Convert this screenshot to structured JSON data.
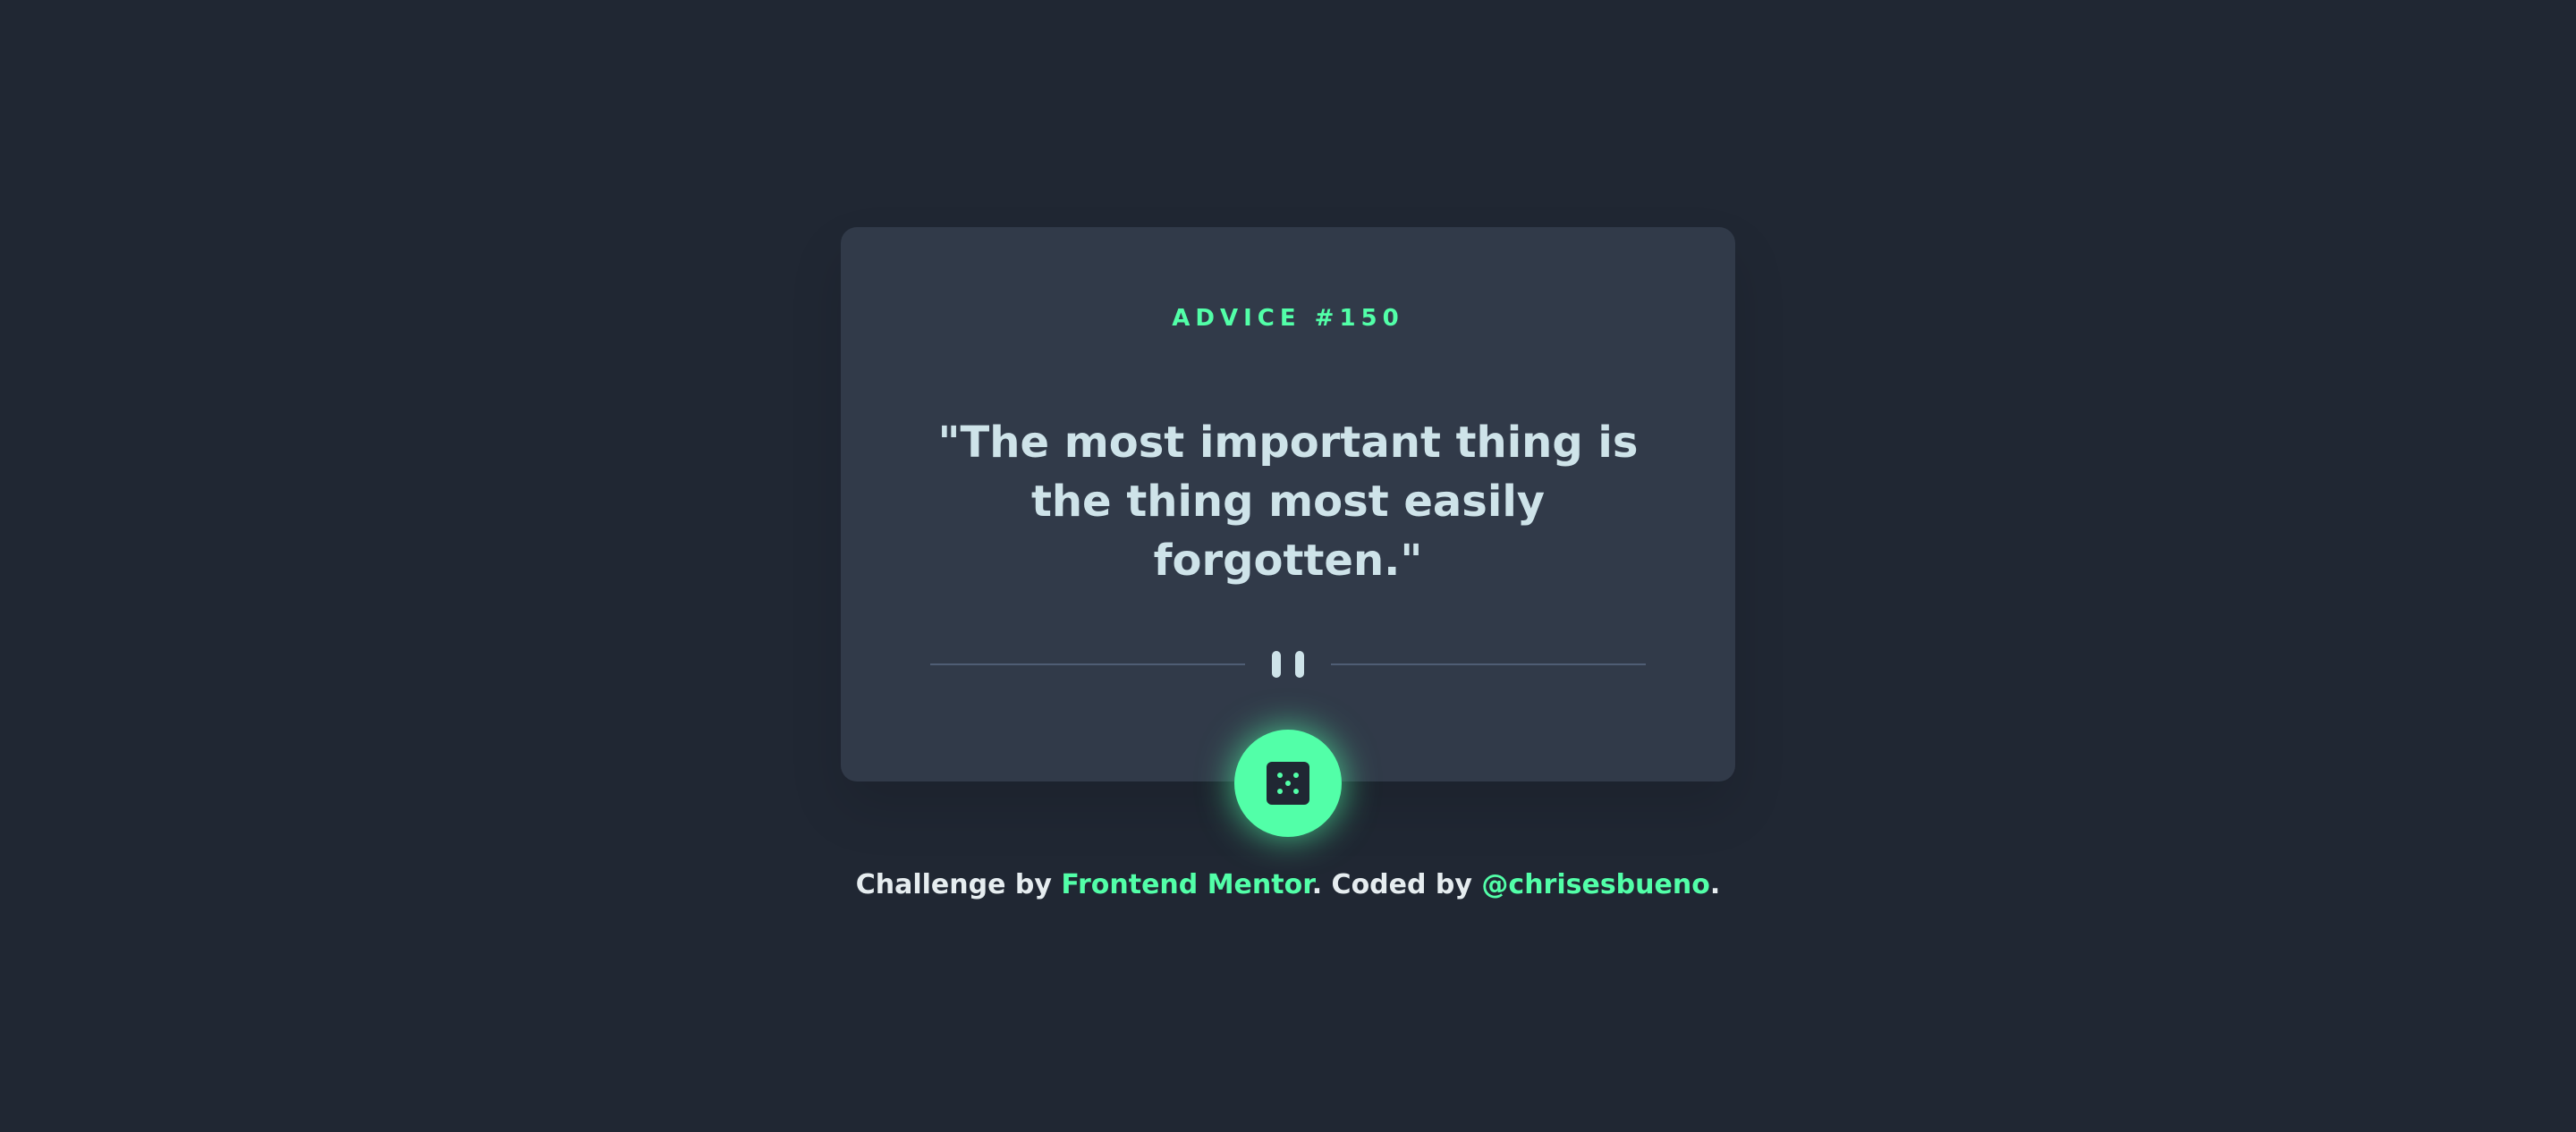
{
  "card": {
    "advice_id": "ADVICE #150",
    "quote": "\"The most important thing is the thing most easily forgotten.\""
  },
  "icons": {
    "divider": "pause-icon",
    "button": "dice-icon"
  },
  "footer": {
    "prefix": "Challenge by ",
    "link1": "Frontend Mentor",
    "middle": ". Coded by ",
    "link2": "@chrisesbueno",
    "suffix": "."
  },
  "colors": {
    "background": "#202733",
    "card": "#313a49",
    "accent": "#52ffa8",
    "text": "#cee3e9",
    "divider": "#4f5d74"
  }
}
